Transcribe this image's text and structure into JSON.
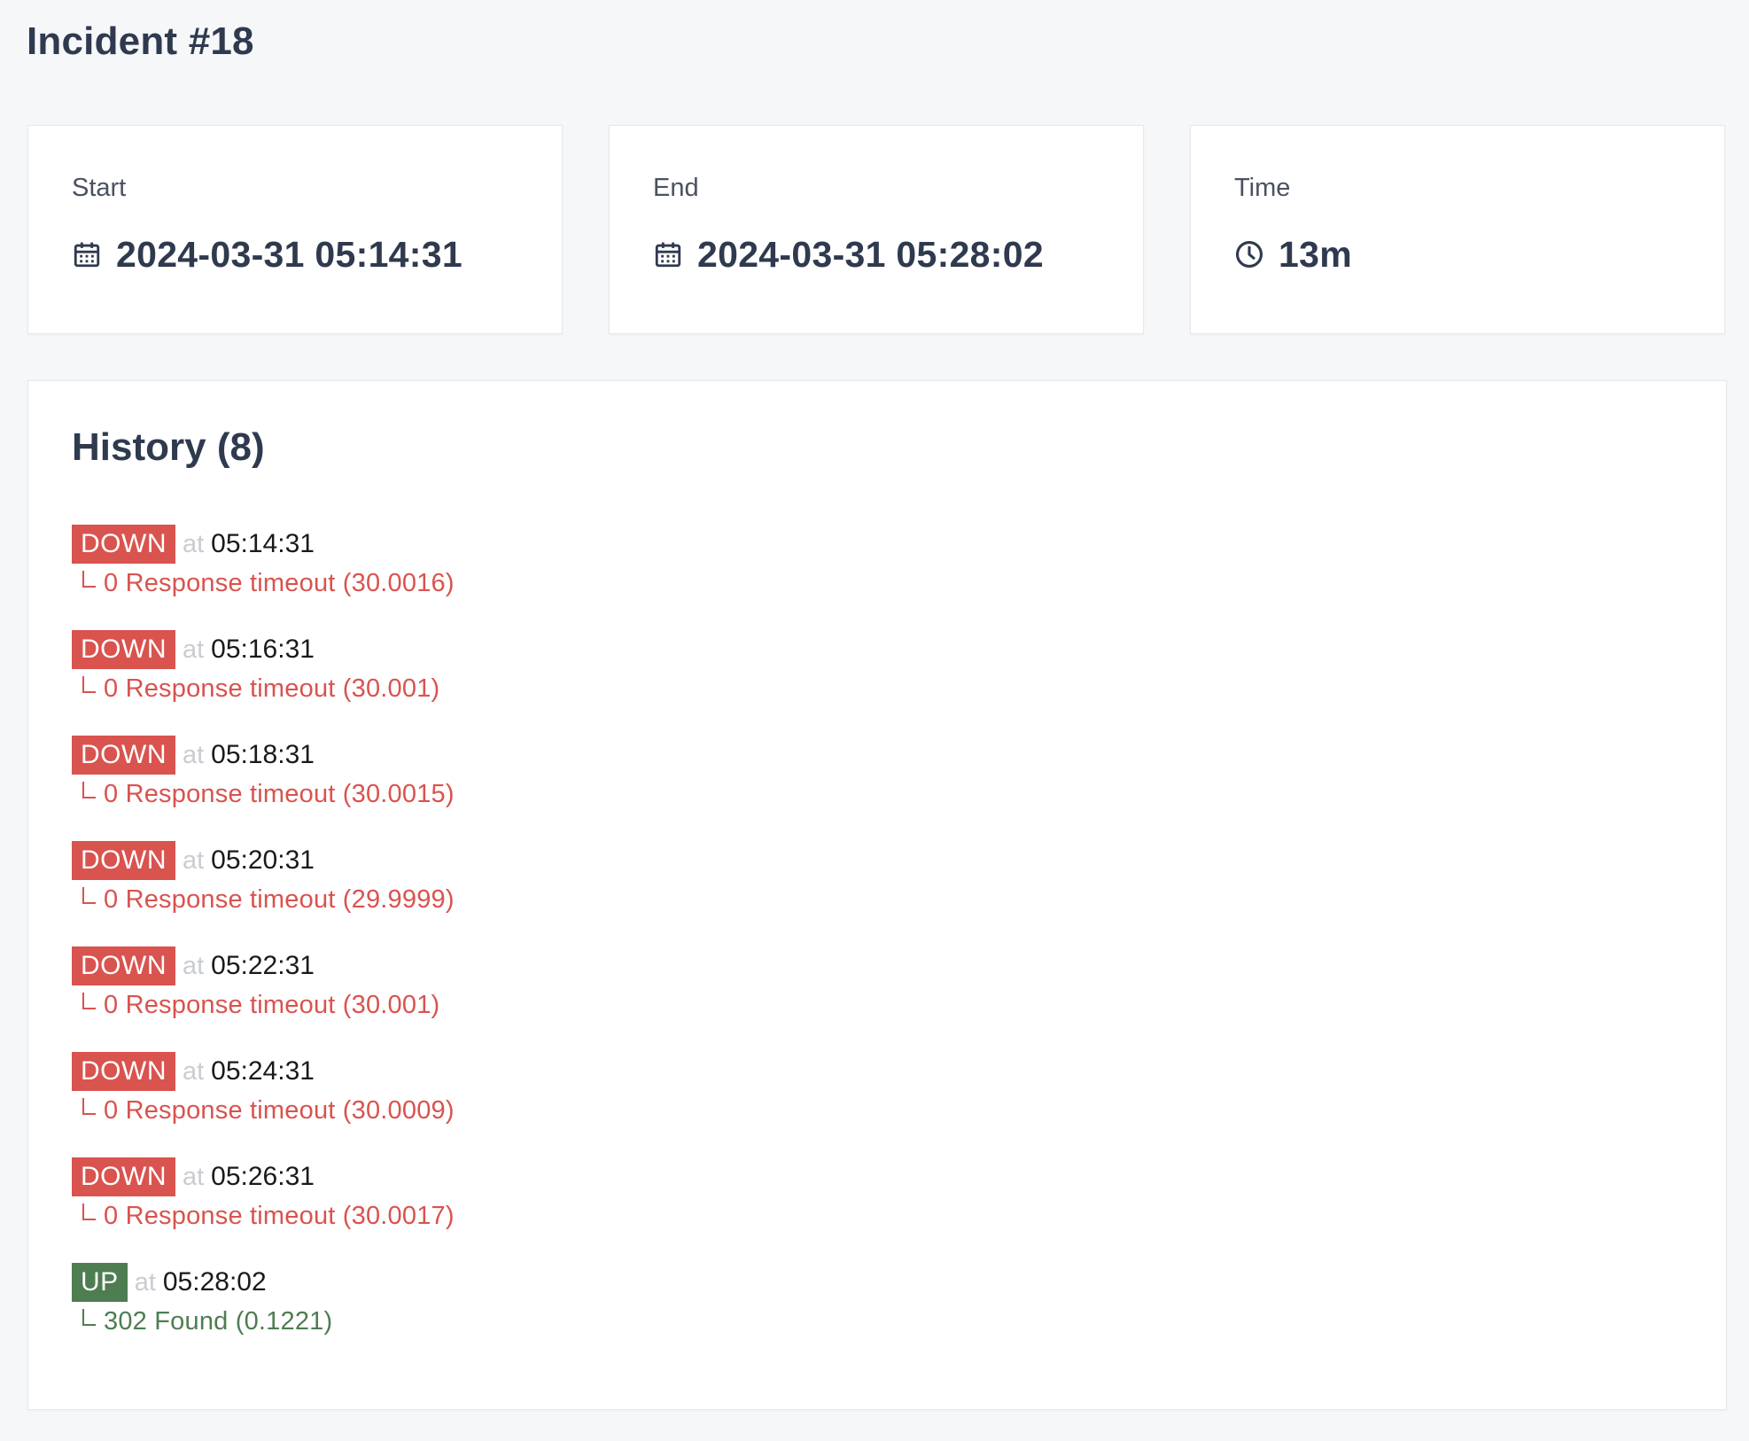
{
  "page": {
    "title": "Incident #18"
  },
  "stats": [
    {
      "label": "Start",
      "value": "2024-03-31 05:14:31",
      "icon": "calendar-icon"
    },
    {
      "label": "End",
      "value": "2024-03-31 05:28:02",
      "icon": "calendar-icon"
    },
    {
      "label": "Time",
      "value": "13m",
      "icon": "clock-icon"
    }
  ],
  "history": {
    "title": "History (8)",
    "at_word": "at",
    "items": [
      {
        "status": "DOWN",
        "time": "05:14:31",
        "detail": "0 Response timeout (30.0016)"
      },
      {
        "status": "DOWN",
        "time": "05:16:31",
        "detail": "0 Response timeout (30.001)"
      },
      {
        "status": "DOWN",
        "time": "05:18:31",
        "detail": "0 Response timeout (30.0015)"
      },
      {
        "status": "DOWN",
        "time": "05:20:31",
        "detail": "0 Response timeout (29.9999)"
      },
      {
        "status": "DOWN",
        "time": "05:22:31",
        "detail": "0 Response timeout (30.001)"
      },
      {
        "status": "DOWN",
        "time": "05:24:31",
        "detail": "0 Response timeout (30.0009)"
      },
      {
        "status": "DOWN",
        "time": "05:26:31",
        "detail": "0 Response timeout (30.0017)"
      },
      {
        "status": "UP",
        "time": "05:28:02",
        "detail": "302 Found (0.1221)"
      }
    ]
  },
  "colors": {
    "down": "#d9534f",
    "up": "#4e7d52",
    "heading": "#2f3a4f",
    "background": "#f6f7f9"
  }
}
